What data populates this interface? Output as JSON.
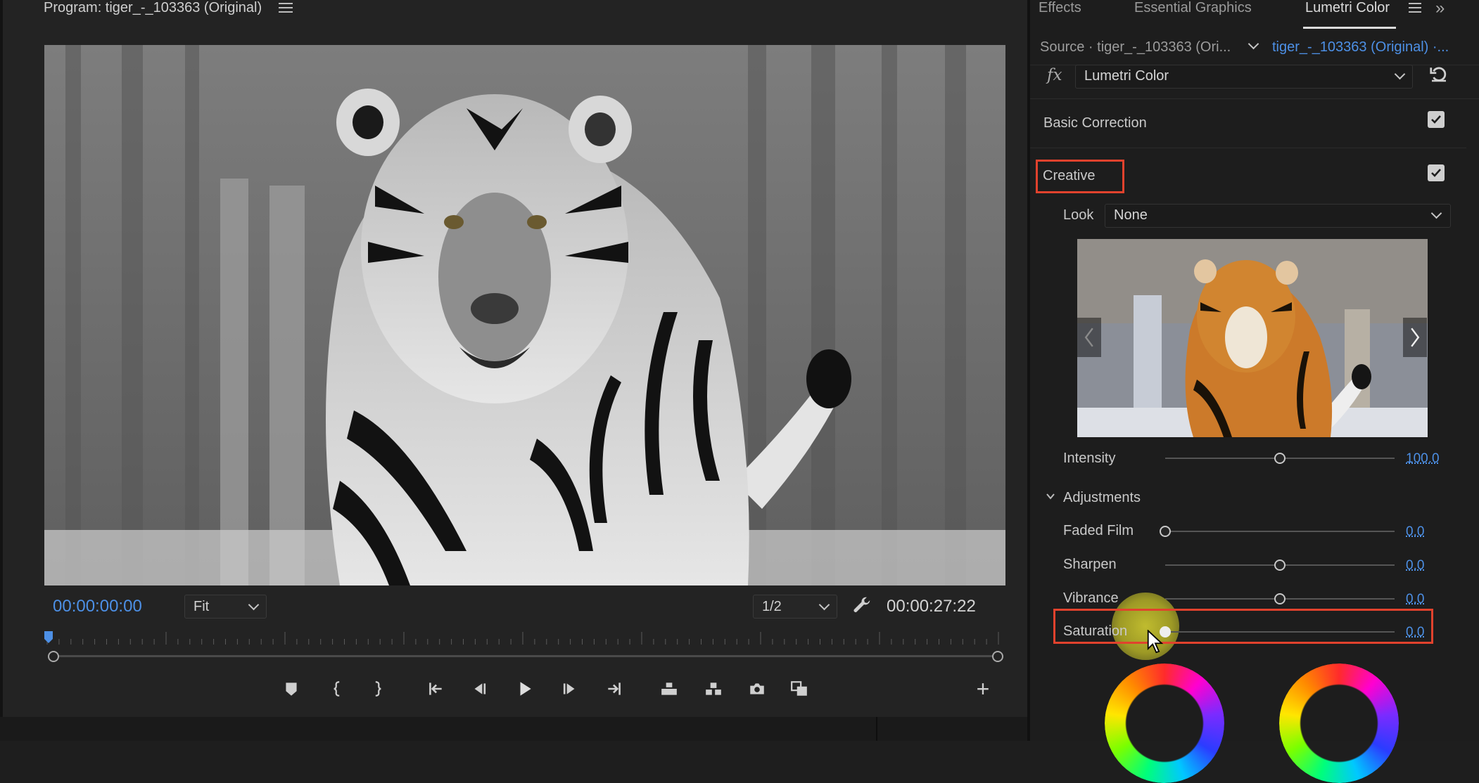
{
  "program_monitor": {
    "title": "Program: tiger_-_103363 (Original)",
    "timecode_current": "00:00:00:00",
    "zoom": "Fit",
    "resolution": "1/2",
    "timecode_duration": "00:00:27:22"
  },
  "panel": {
    "tabs": [
      "Effects",
      "Essential Graphics",
      "Lumetri Color"
    ],
    "active_tab": "Lumetri Color",
    "source_label": "Source · tiger_-_103363 (Ori...",
    "sequence_label": "tiger_-_103363 (Original) ·...",
    "fx_badge": "fx",
    "effect": "Lumetri Color",
    "sections": {
      "basic_correction": "Basic Correction",
      "creative": "Creative"
    },
    "look": {
      "label": "Look",
      "value": "None"
    },
    "intensity": {
      "label": "Intensity",
      "value": "100.0",
      "fraction": 0.5
    },
    "adjustments": {
      "label": "Adjustments",
      "sliders": [
        {
          "label": "Faded Film",
          "value": "0.0",
          "fraction": 0.0
        },
        {
          "label": "Sharpen",
          "value": "0.0",
          "fraction": 0.5
        },
        {
          "label": "Vibrance",
          "value": "0.0",
          "fraction": 0.5
        },
        {
          "label": "Saturation",
          "value": "0.0",
          "fraction": 0.0
        }
      ]
    }
  },
  "colors": {
    "accent_blue": "#4d90e6",
    "highlight_red": "#e1422d",
    "cursor_halo": "#dcd732"
  },
  "icons": {
    "transport": [
      "marker-icon",
      "mark-in-icon",
      "mark-out-icon",
      "go-to-in-icon",
      "step-back-icon",
      "play-icon",
      "step-forward-icon",
      "go-to-out-icon",
      "lift-icon",
      "extract-icon",
      "export-frame-icon",
      "comparison-view-icon"
    ]
  }
}
